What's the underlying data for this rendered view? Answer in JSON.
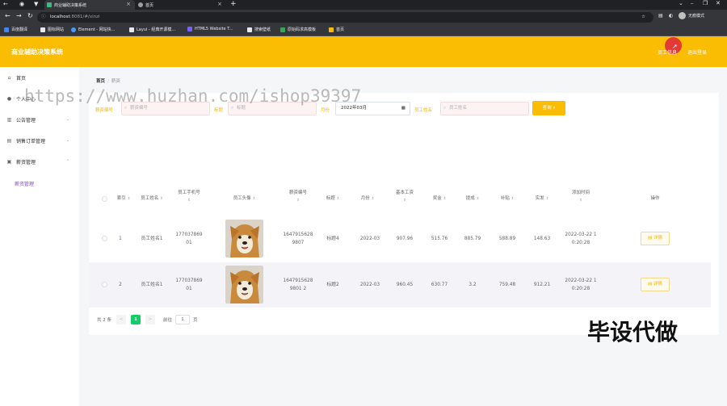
{
  "browser": {
    "tabs": [
      {
        "title": "商业辅助决策系统",
        "active": true
      },
      {
        "title": "首页",
        "active": false
      }
    ],
    "url_host": "localhost",
    "url_path": ":8081/#/xinzi",
    "profile_label": "无痕模式",
    "bookmarks": [
      "百度翻译",
      "图标网站",
      "Element - 网站快...",
      "Layui - 经典开源模...",
      "HTML5 Website T...",
      "搜索壁纸",
      "原始码求高模板",
      "首页"
    ],
    "colors": {
      "chrome_bg": "#202124",
      "toolbar_bg": "#35363a"
    }
  },
  "app": {
    "title": "商业辅助决策系统",
    "top_links": [
      "员工信息",
      "退出登录"
    ],
    "colors": {
      "accent": "#fbbc04",
      "page_bg": "#f5f6f8",
      "pager_active": "#13ce66",
      "submenu": "#8a4bd0"
    }
  },
  "sidebar": {
    "items": [
      {
        "label": "首页",
        "icon": "home-icon"
      },
      {
        "label": "个人中心",
        "icon": "user-icon"
      },
      {
        "label": "公告管理",
        "icon": "notice-icon"
      },
      {
        "label": "销售订单管理",
        "icon": "order-icon"
      },
      {
        "label": "薪资管理",
        "icon": "salary-icon"
      }
    ],
    "sub_item": "薪资管理"
  },
  "breadcrumb": {
    "home": "首页",
    "current": "薪资"
  },
  "search": {
    "label_gongzhang": "薪资编号",
    "placeholder_gongzhang": "薪资编号",
    "label_biaoti": "标题",
    "placeholder_biaoti": "标题",
    "label_yuefen": "月份",
    "value_yuefen": "2022年03月",
    "label_name": "员工姓名",
    "placeholder_name": "员工姓名",
    "button": "查询"
  },
  "table": {
    "headers": [
      "索引",
      "员工姓名",
      "员工手机号",
      "员工头像",
      "薪资编号",
      "标题",
      "月份",
      "基本工资",
      "奖金",
      "提成",
      "补贴",
      "实发",
      "添加时间",
      "操作"
    ],
    "rows": [
      {
        "index": "1",
        "name": "员工姓名1",
        "phone": "17703786901",
        "salary_no": "16479156289807",
        "title": "标题4",
        "month": "2022-03",
        "base": "907.96",
        "bonus": "515.76",
        "commission": "885.79",
        "allowance": "588.89",
        "actual": "148.63",
        "added": "2022-03-22 10:20:28",
        "action": "详情"
      },
      {
        "index": "2",
        "name": "员工姓名1",
        "phone": "17703786901",
        "salary_no": "16479156289801 2",
        "title": "标题2",
        "month": "2022-03",
        "base": "960.45",
        "bonus": "630.77",
        "commission": "3.2",
        "allowance": "759.48",
        "actual": "912.21",
        "added": "2022-03-22 10:20:28",
        "action": "详情"
      }
    ]
  },
  "pager": {
    "total": "共 2 条",
    "prev": "<",
    "page": "1",
    "next": ">",
    "goto": "前往",
    "goto_value": "1",
    "unit": "页"
  },
  "watermark": {
    "url": "https://www.huzhan.com/ishop39397",
    "cn": "毕设代做"
  }
}
